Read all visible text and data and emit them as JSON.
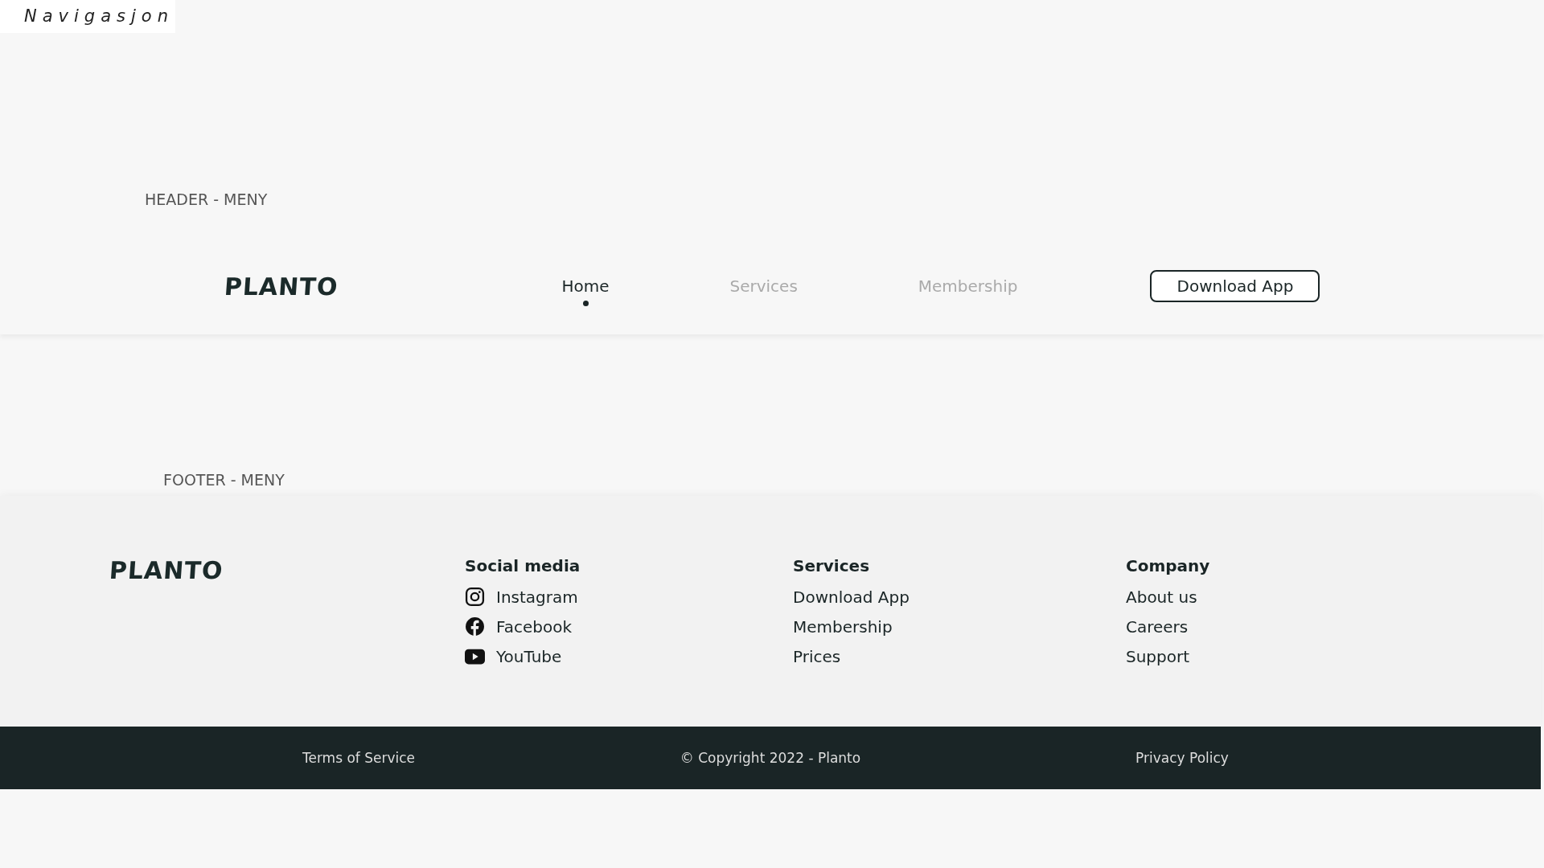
{
  "page_label": "Navigasjon",
  "header_section": {
    "title": "HEADER - MENY",
    "header": {
      "logo": "PLANTO",
      "nav": [
        {
          "label": "Home",
          "selected": true
        },
        {
          "label": "Services",
          "selected": false
        },
        {
          "label": "Membership",
          "selected": false
        }
      ],
      "button": "Download App"
    }
  },
  "footer_section": {
    "title": "FOOTER - MENY",
    "footer": {
      "logo": "PLANTO",
      "columns": [
        {
          "heading": "Social media",
          "kind": "social",
          "links": [
            "Instagram",
            "Facebook",
            "YouTube"
          ]
        },
        {
          "heading": "Services",
          "kind": "plain",
          "links": [
            "Download App",
            "Membership",
            "Prices"
          ]
        },
        {
          "heading": "Company",
          "kind": "plain",
          "links": [
            "About us",
            "Careers",
            "Support"
          ]
        }
      ],
      "bottom_bar": [
        "Terms of Service",
        "© Copyright 2022 - Planto",
        "Privacy Policy"
      ]
    }
  }
}
